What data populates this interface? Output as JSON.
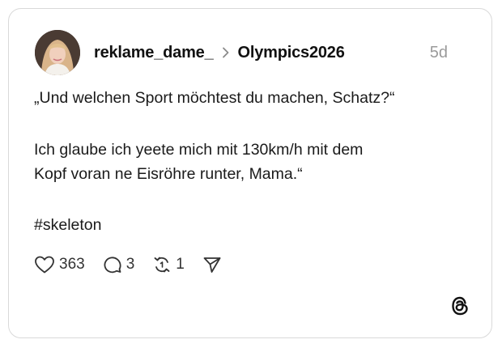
{
  "post": {
    "username": "reklame_dame_",
    "community": "Olympics2026",
    "timestamp": "5d",
    "lines": [
      "„Und welchen Sport möchtest du machen, Schatz?“",
      "Ich glaube ich yeete mich mit 130km/h mit dem",
      "Kopf voran ne Eisröhre runter, Mama.“",
      "#skeleton"
    ],
    "likes": "363",
    "replies": "3",
    "reposts": "1"
  },
  "icons": {
    "like": "heart-icon",
    "reply": "speech-bubble-icon",
    "repost": "repost-icon",
    "share": "send-icon",
    "brand": "threads-logo-icon",
    "navigation": "chevron-right-icon"
  },
  "colors": {
    "text": "#1a1a1a",
    "muted": "#9a9a9a",
    "border": "#d9d9d9"
  }
}
